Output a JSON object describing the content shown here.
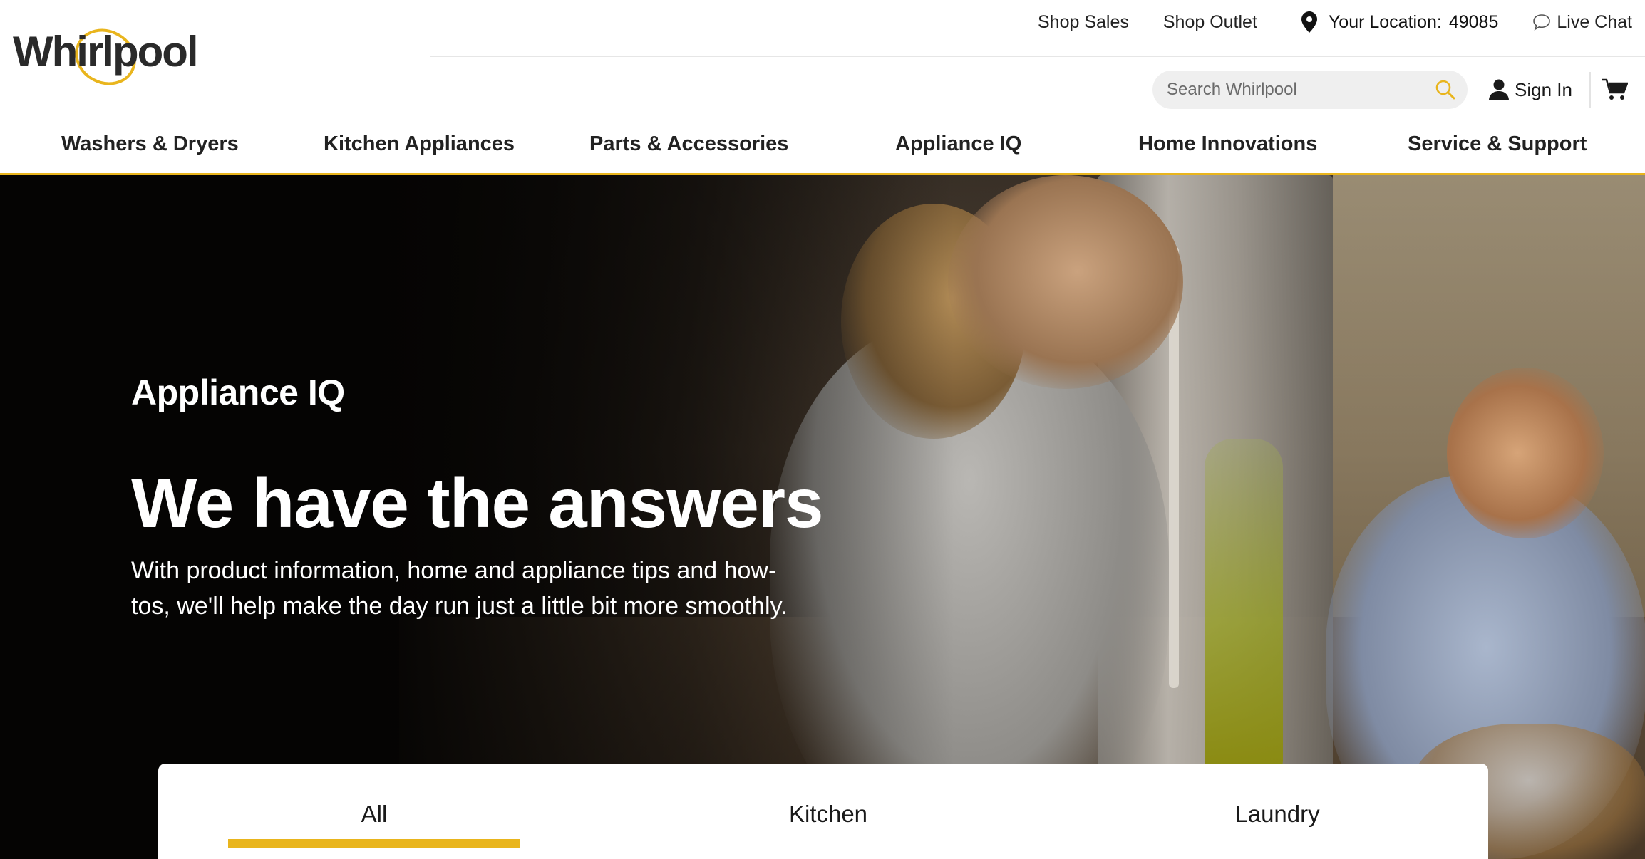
{
  "brand": {
    "name": "Whirlpool",
    "accent_color": "#e9b51d"
  },
  "utility": {
    "shop_sales": "Shop Sales",
    "shop_outlet": "Shop Outlet",
    "location_label": "Your Location:",
    "location_zip": "49085",
    "live_chat": "Live Chat"
  },
  "search": {
    "placeholder": "Search Whirlpool",
    "icon": "search-icon"
  },
  "account": {
    "sign_in": "Sign In",
    "cart_icon": "cart-icon"
  },
  "nav": {
    "items": [
      "Washers & Dryers",
      "Kitchen Appliances",
      "Parts & Accessories",
      "Appliance IQ",
      "Home Innovations",
      "Service & Support"
    ]
  },
  "hero": {
    "eyebrow": "Appliance IQ",
    "title": "We have the answers",
    "subtitle": "With product information, home and appliance tips and how-tos, we'll help make the day run just a little bit more smoothly."
  },
  "tabs": {
    "items": [
      "All",
      "Kitchen",
      "Laundry"
    ],
    "active": "All"
  }
}
